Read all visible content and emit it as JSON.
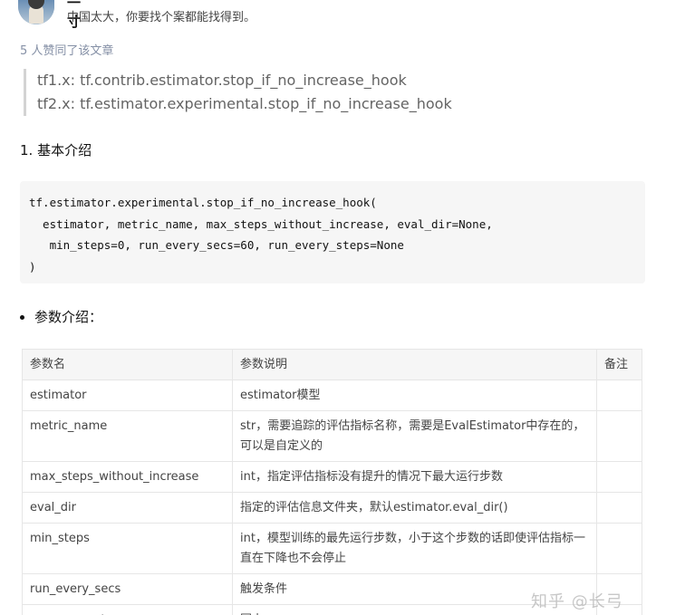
{
  "author": {
    "name": "一寸",
    "bio": "中国太大，你要找个案都能找得到。"
  },
  "likes_text": "5 人赞同了该文章",
  "quote_lines": [
    "tf1.x: tf.contrib.estimator.stop_if_no_increase_hook",
    "tf2.x: tf.estimator.experimental.stop_if_no_increase_hook"
  ],
  "section_title": "1. 基本介绍",
  "code_block": "tf.estimator.experimental.stop_if_no_increase_hook(\n  estimator, metric_name, max_steps_without_increase, eval_dir=None,\n   min_steps=0, run_every_secs=60, run_every_steps=None\n)",
  "bullet_text": "参数介绍：",
  "table": {
    "headers": [
      "参数名",
      "参数说明",
      "备注"
    ],
    "rows": [
      [
        "estimator",
        "estimator模型",
        ""
      ],
      [
        "metric_name",
        "str，需要追踪的评估指标名称，需要是EvalEstimator中存在的，可以是自定义的",
        ""
      ],
      [
        "max_steps_without_increase",
        "int，指定评估指标没有提升的情况下最大运行步数",
        ""
      ],
      [
        "eval_dir",
        "指定的评估信息文件夹，默认estimator.eval_dir()",
        ""
      ],
      [
        "min_steps",
        "int，模型训练的最先运行步数，小于这个步数的话即使评估指标一直在下降也不会停止",
        ""
      ],
      [
        "run_every_secs",
        "触发条件",
        ""
      ],
      [
        "run_every_steps",
        "同上",
        ""
      ]
    ]
  },
  "watermark": "知乎 @长弓"
}
